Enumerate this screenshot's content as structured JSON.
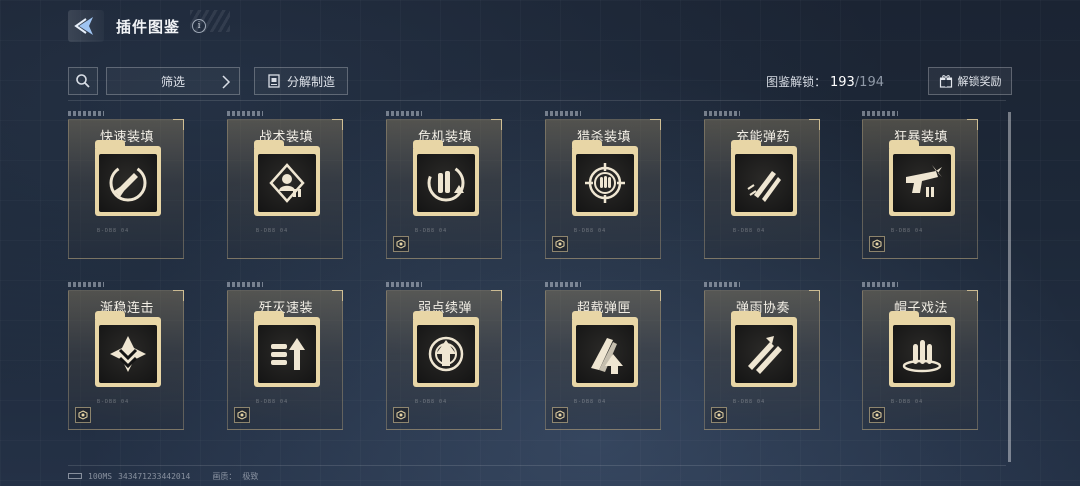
{
  "header": {
    "title": "插件图鉴",
    "info_glyph": "i"
  },
  "toolbar": {
    "filter_label": "筛选",
    "decompose_label": "分解制造",
    "unlock_label": "图鉴解锁：",
    "unlock_current": "193",
    "unlock_sep": "/",
    "unlock_total": "194",
    "reward_label": "解锁奖励"
  },
  "cards": [
    {
      "name": "快速装填",
      "icon": "rocket-reload-icon",
      "badge": false
    },
    {
      "name": "战术装填",
      "icon": "tactical-target-icon",
      "badge": false
    },
    {
      "name": "危机装填",
      "icon": "crisis-ammo-icon",
      "badge": true
    },
    {
      "name": "猎杀装填",
      "icon": "crosshair-ammo-icon",
      "badge": true
    },
    {
      "name": "充能弹药",
      "icon": "charged-bullets-icon",
      "badge": false
    },
    {
      "name": "狂暴装填",
      "icon": "berserk-gun-icon",
      "badge": true
    },
    {
      "name": "渐稳连击",
      "icon": "steady-combo-icon",
      "badge": true
    },
    {
      "name": "歼灭速装",
      "icon": "annihilate-bullets-icon",
      "badge": true
    },
    {
      "name": "弱点续弹",
      "icon": "weakpoint-target-icon",
      "badge": true
    },
    {
      "name": "超载弹匣",
      "icon": "overload-magazine-icon",
      "badge": true
    },
    {
      "name": "弹雨协奏",
      "icon": "bullet-rain-icon",
      "badge": true
    },
    {
      "name": "帽子戏法",
      "icon": "hat-trick-bullets-icon",
      "badge": true
    }
  ],
  "footer": {
    "ping": "100MS",
    "uid": "343471233442014",
    "quality_label": "画质：",
    "quality_value": "极致"
  },
  "colors": {
    "accent": "#e8d6a6",
    "bg": "#1d2838"
  }
}
